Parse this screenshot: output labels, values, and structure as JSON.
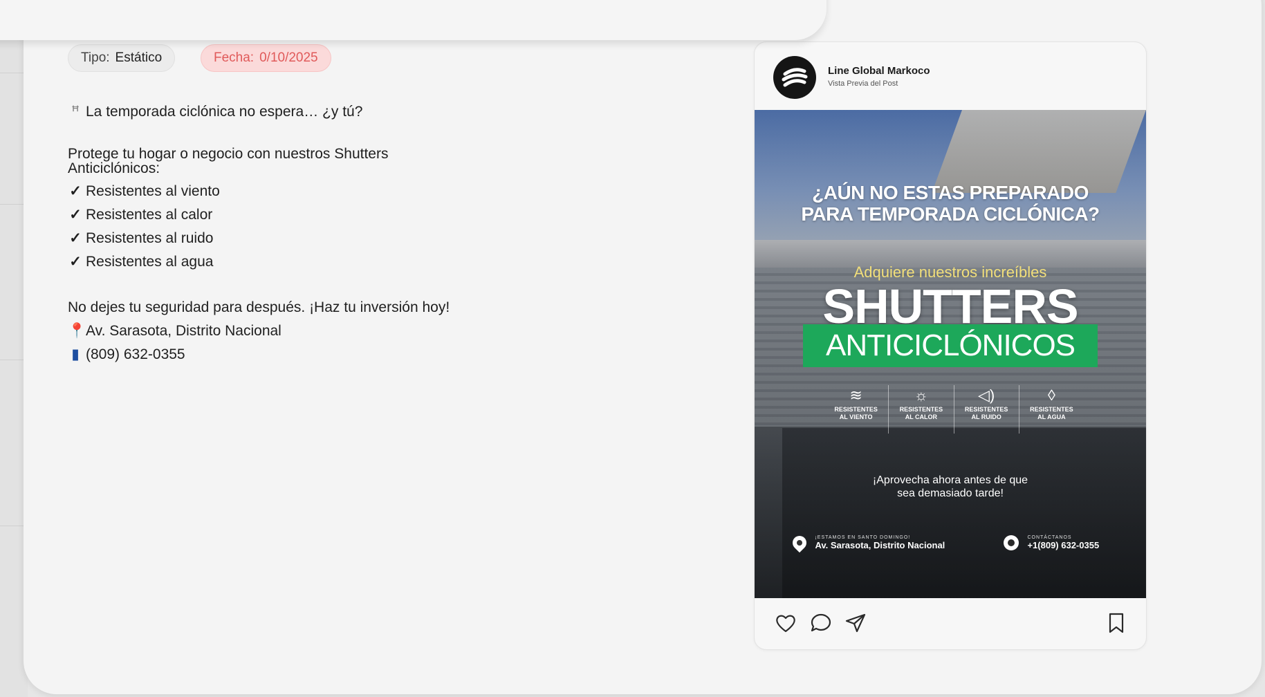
{
  "meta_tag": {
    "tipo_label": "Tipo:",
    "tipo_value": "Estático",
    "fecha_label": "Fecha:",
    "fecha_value": "0/10/2025"
  },
  "caption": {
    "hook": "La temporada ciclónica no espera… ¿y tú?",
    "hook_icon": "cyclone-icon",
    "intro": "Protege tu hogar o negocio con nuestros Shutters Anticiclónicos:",
    "checks": [
      "Resistentes al viento",
      "Resistentes al calor",
      "Resistentes al ruido",
      "Resistentes al agua"
    ],
    "cta": "No dejes tu seguridad para después. ¡Haz tu inversión hoy!",
    "address": "Av. Sarasota, Distrito Nacional",
    "phone": "(809) 632-0355"
  },
  "post": {
    "account_name": "Line Global Markoco",
    "account_sub": "Vista Previa del Post",
    "creative": {
      "headline_1": "¿AÚN NO ESTAS PREPARADO",
      "headline_2": "PARA TEMPORADA CICLÓNICA?",
      "subhead": "Adquiere nuestros increíbles",
      "big": "SHUTTERS",
      "green": "ANTICICLÓNICOS",
      "features": [
        {
          "icon": "wind-icon",
          "glyph": "≋",
          "l1": "RESISTENTES",
          "l2": "AL VIENTO"
        },
        {
          "icon": "sun-icon",
          "glyph": "☼",
          "l1": "RESISTENTES",
          "l2": "AL CALOR"
        },
        {
          "icon": "speaker-icon",
          "glyph": "◁)",
          "l1": "RESISTENTES",
          "l2": "AL RUIDO"
        },
        {
          "icon": "drop-icon",
          "glyph": "◊",
          "l1": "RESISTENTES",
          "l2": "AL AGUA"
        }
      ],
      "cta_1": "¡Aprovecha ahora antes de que",
      "cta_2": "sea demasiado tarde!",
      "loc_small": "¡ESTAMOS EN SANTO DOMINGO!",
      "loc_main": "Av. Sarasota, Distrito Nacional",
      "ph_small": "CONTÁCTANOS",
      "ph_main": "+1(809) 632-0355"
    }
  },
  "colors": {
    "accent_green": "#1da85a",
    "date_badge_bg": "#fbdada",
    "date_badge_text": "#e05a5a"
  }
}
